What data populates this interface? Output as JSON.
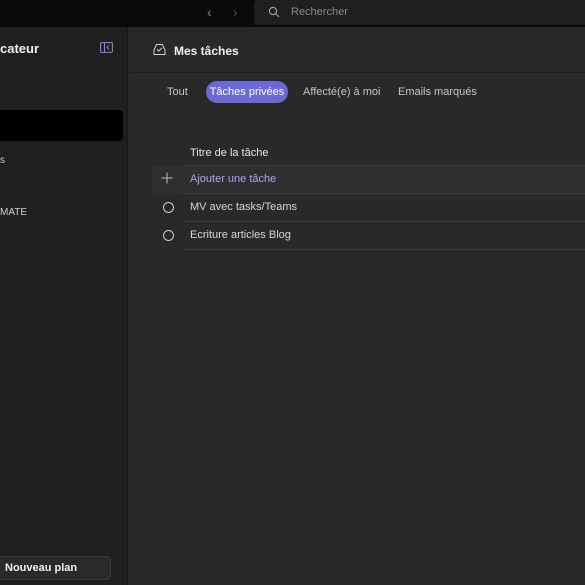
{
  "topbar": {
    "search_placeholder": "Rechercher"
  },
  "sidebar": {
    "title": "cateur",
    "items": [
      {
        "label": "s"
      },
      {
        "label": "MATE"
      }
    ],
    "new_plan_label": "Nouveau plan"
  },
  "main": {
    "title": "Mes tâches",
    "tabs": [
      {
        "label": "Tout"
      },
      {
        "label": "Tâches privées",
        "active": true
      },
      {
        "label": "Affecté(e) à moi"
      },
      {
        "label": "Emails marqués"
      }
    ],
    "column_header": "Titre de la tâche",
    "add_task_label": "Ajouter une tâche",
    "tasks": [
      {
        "title": "MV avec tasks/Teams"
      },
      {
        "title": "Ecriture articles Blog"
      }
    ]
  },
  "colors": {
    "accent": "#6b69d6",
    "accent_text": "#a7a6f5",
    "background": "#292929",
    "sidebar": "#1f1f1f",
    "topbar": "#0a0a0a"
  }
}
